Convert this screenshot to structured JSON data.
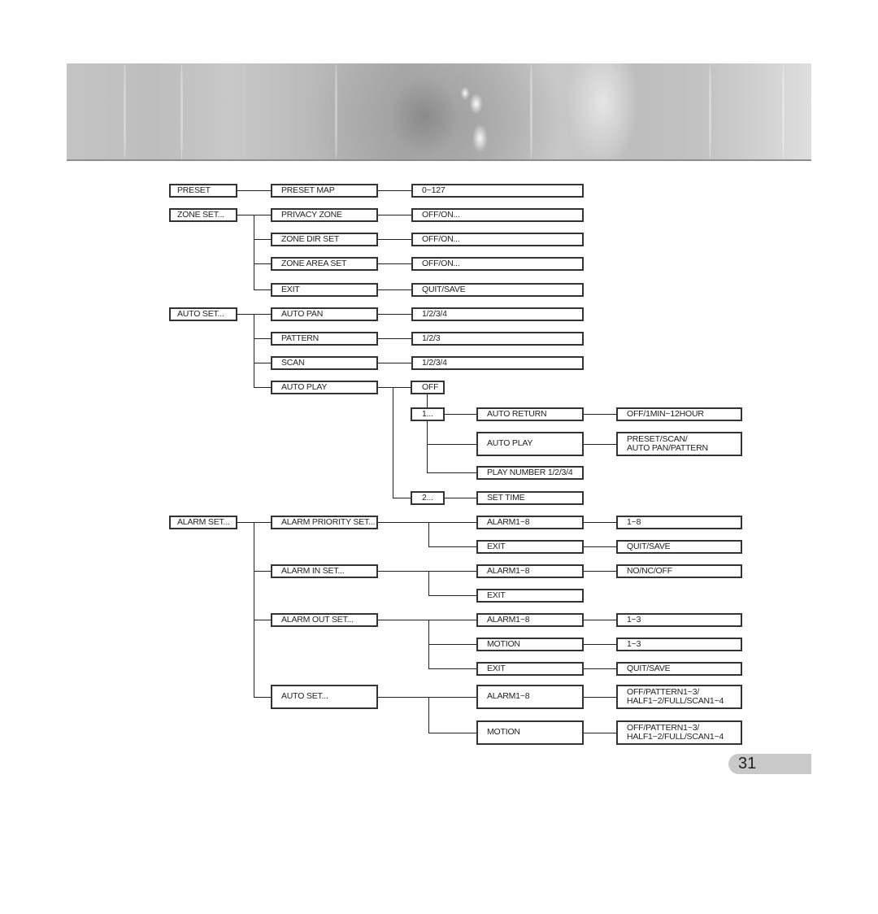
{
  "page": {
    "page_number": "31",
    "banner": "camera-lens-header-image"
  },
  "menu_tree": {
    "preset": {
      "label": "PRESET",
      "children": [
        {
          "label": "PRESET MAP",
          "value": "0~127"
        }
      ]
    },
    "zone_set": {
      "label": "ZONE SET...",
      "children": [
        {
          "label": "PRIVACY ZONE",
          "value": "OFF/ON..."
        },
        {
          "label": "ZONE DIR SET",
          "value": "OFF/ON..."
        },
        {
          "label": "ZONE AREA SET",
          "value": "OFF/ON..."
        },
        {
          "label": "EXIT",
          "value": "QUIT/SAVE"
        }
      ]
    },
    "auto_set": {
      "label": "AUTO SET...",
      "children": [
        {
          "label": "AUTO PAN",
          "value": "1/2/3/4"
        },
        {
          "label": "PATTERN",
          "value": "1/2/3"
        },
        {
          "label": "SCAN",
          "value": "1/2/3/4"
        },
        {
          "label": "AUTO PLAY"
        }
      ],
      "auto_play": {
        "off": "OFF",
        "one": {
          "label": "1...",
          "children": [
            {
              "label": "AUTO RETURN",
              "value": "OFF/1MIN~12HOUR"
            },
            {
              "label": "AUTO PLAY",
              "value": "PRESET/SCAN/\nAUTO PAN/PATTERN"
            },
            {
              "label": "PLAY NUMBER 1/2/3/4"
            }
          ]
        },
        "two": {
          "label": "2...",
          "children": [
            {
              "label": "SET TIME"
            }
          ]
        }
      }
    },
    "alarm_set": {
      "label": "ALARM SET...",
      "children": [
        {
          "label": "ALARM PRIORITY SET...",
          "children": [
            {
              "label": "ALARM1~8",
              "value": "1~8"
            },
            {
              "label": "EXIT",
              "value": "QUIT/SAVE"
            }
          ]
        },
        {
          "label": "ALARM IN SET...",
          "children": [
            {
              "label": "ALARM1~8",
              "value": "NO/NC/OFF"
            },
            {
              "label": "EXIT"
            }
          ]
        },
        {
          "label": "ALARM OUT SET...",
          "children": [
            {
              "label": "ALARM1~8",
              "value": "1~3"
            },
            {
              "label": "MOTION",
              "value": "1~3"
            },
            {
              "label": "EXIT",
              "value": "QUIT/SAVE"
            }
          ]
        },
        {
          "label": "AUTO SET...",
          "children": [
            {
              "label": "ALARM1~8",
              "value": "OFF/PATTERN1~3/\nHALF1~2/FULL/SCAN1~4"
            },
            {
              "label": "MOTION",
              "value": "OFF/PATTERN1~3/\nHALF1~2/FULL/SCAN1~4"
            }
          ]
        }
      ]
    }
  }
}
